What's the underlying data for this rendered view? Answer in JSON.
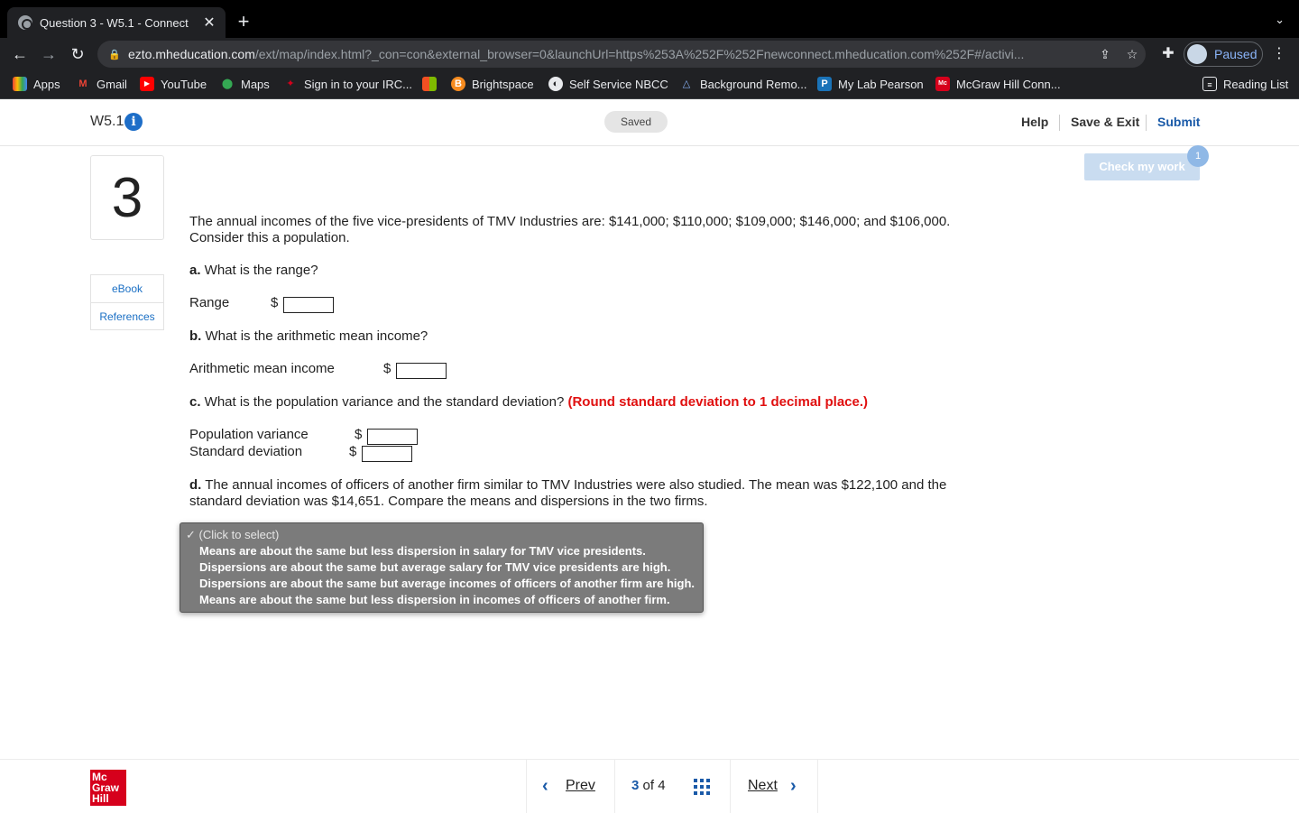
{
  "browser": {
    "tab_title": "Question 3 - W5.1 - Connect",
    "url_host": "ezto.mheducation.com",
    "url_path": "/ext/map/index.html?_con=con&external_browser=0&launchUrl=https%253A%252F%252Fnewconnect.mheducation.com%252F#/activi...",
    "profile_label": "Paused",
    "bookmarks": [
      "Apps",
      "Gmail",
      "YouTube",
      "Maps",
      "Sign in to your IRC...",
      "Brightspace",
      "Self Service NBCC",
      "Background Remo...",
      "My Lab Pearson",
      "McGraw Hill Conn..."
    ],
    "reading_list": "Reading List"
  },
  "header": {
    "assignment": "W5.1",
    "status": "Saved",
    "help": "Help",
    "save_exit": "Save & Exit",
    "submit": "Submit"
  },
  "sidebar": {
    "question_number": "3",
    "resources": [
      "eBook",
      "References"
    ]
  },
  "check_work": {
    "label": "Check my work",
    "badge": "1"
  },
  "question": {
    "intro_line1": "The annual incomes of the five vice-presidents of TMV Industries are: $141,000; $110,000; $109,000; $146,000; and $106,000.",
    "intro_line2": "Consider this a population.",
    "part_a_letter": "a.",
    "part_a_text": " What is the range?",
    "range_label": "Range",
    "part_b_letter": "b.",
    "part_b_text": " What is the arithmetic mean income?",
    "mean_label": "Arithmetic mean income",
    "part_c_letter": "c.",
    "part_c_text": " What is the population variance and the standard deviation? ",
    "part_c_note": "(Round standard deviation to 1 decimal place.)",
    "variance_label": "Population variance",
    "stddev_label": "Standard deviation",
    "currency": "$",
    "part_d_letter": "d.",
    "part_d_line1": " The annual incomes of officers of another firm similar to TMV Industries were also studied. The mean was $122,100 and the",
    "part_d_line2": "standard deviation was $14,651. Compare the means and dispersions in the two firms."
  },
  "dropdown": {
    "selected": "✓ (Click to select)",
    "options": [
      "Means are about the same but less dispersion in salary for TMV vice presidents.",
      "Dispersions are about the same but average salary for TMV vice presidents are high.",
      "Dispersions are about the same but average incomes of officers of another firm are high.",
      "Means are about the same but less dispersion in incomes of officers of another firm."
    ]
  },
  "footer": {
    "logo_lines": [
      "Mc",
      "Graw",
      "Hill"
    ],
    "prev": "Prev",
    "current": "3",
    "of_word": "of",
    "total": "4",
    "next": "Next"
  },
  "colors": {
    "accent_blue": "#1a5aa8",
    "required_red": "#e01010",
    "brand_red": "#d6001c"
  }
}
